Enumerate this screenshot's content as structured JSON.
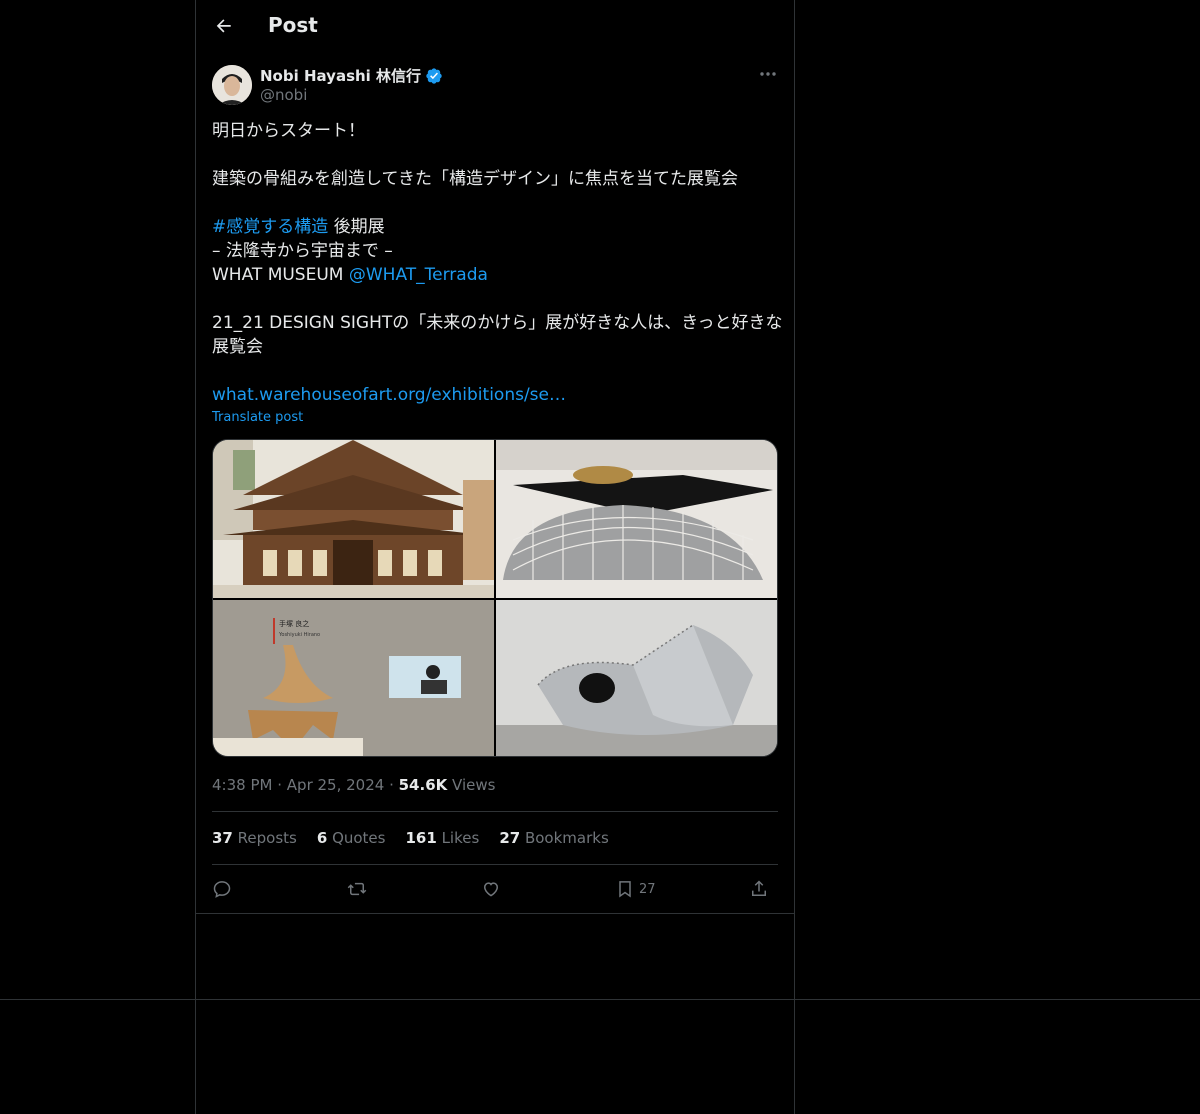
{
  "header": {
    "title": "Post"
  },
  "author": {
    "name": "Nobi Hayashi 林信行",
    "handle": "@nobi"
  },
  "tweet": {
    "lines": {
      "l1": "明日からスタート！",
      "l2": "建築の骨組みを創造してきた「構造デザイン」に焦点を当てた展覧会",
      "hashtag": "#感覚する構造",
      "l3_rest": " 後期展",
      "l4": "– 法隆寺から宇宙まで –",
      "l5_prefix": "WHAT MUSEUM ",
      "mention": "@WHAT_Terrada",
      "l6": "21_21 DESIGN SIGHTの「未来のかけら」展が好きな人は、きっと好きな",
      "l7": "展覧会",
      "url": "what.warehouseofart.org/exhibitions/se…"
    },
    "translate": "Translate post"
  },
  "media": {
    "images": [
      "temple-model",
      "wire-mesh-dome",
      "wooden-sculpture",
      "metal-sculpture"
    ],
    "caption_name": "手塚 良之",
    "caption_sub": "Yoshiyuki Hirano"
  },
  "meta": {
    "time": "4:38 PM",
    "date": "Apr 25, 2024",
    "views_count": "54.6K",
    "views_label": "Views"
  },
  "stats": {
    "reposts_count": "37",
    "reposts_label": "Reposts",
    "quotes_count": "6",
    "quotes_label": "Quotes",
    "likes_count": "161",
    "likes_label": "Likes",
    "bookmarks_count": "27",
    "bookmarks_label": "Bookmarks"
  },
  "actions": {
    "bookmark_count": "27"
  },
  "colors": {
    "background": "#000000",
    "text": "#e7e9ea",
    "muted": "#71767b",
    "link": "#1d9bf0",
    "divider": "#2f3336",
    "verified": "#1d9bf0"
  },
  "icons": [
    "back-arrow-icon",
    "verified-icon",
    "more-icon",
    "reply-icon",
    "repost-icon",
    "like-icon",
    "bookmark-icon",
    "share-icon"
  ]
}
